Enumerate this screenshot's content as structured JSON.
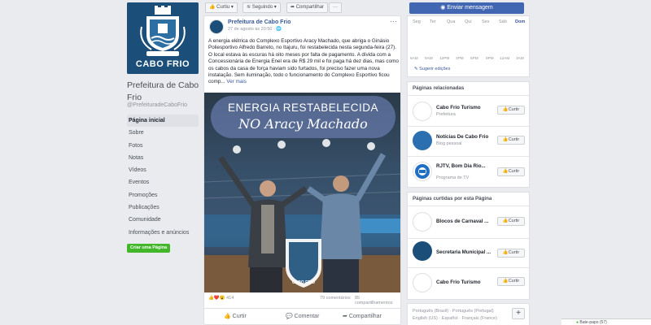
{
  "page": {
    "cover_text": "CABO FRIO",
    "name": "Prefeitura de Cabo Frio",
    "handle": "@PrefeituradeCaboFrio",
    "create_page": "Criar uma Página"
  },
  "nav": [
    {
      "label": "Página inicial"
    },
    {
      "label": "Sobre"
    },
    {
      "label": "Fotos"
    },
    {
      "label": "Notas"
    },
    {
      "label": "Vídeos"
    },
    {
      "label": "Eventos"
    },
    {
      "label": "Promoções"
    },
    {
      "label": "Publicações"
    },
    {
      "label": "Comunidade"
    },
    {
      "label": "Informações e anúncios"
    }
  ],
  "toolbar": {
    "like": "Curtiu",
    "follow": "Seguindo",
    "share": "Compartilhar",
    "more": "···",
    "send_message": "Enviar mensagem"
  },
  "post": {
    "author": "Prefeitura de Cabo Frio",
    "time": "27 de agosto às 20:50 · 🌐",
    "text": "A energia elétrica do Complexo Esportivo Aracy Machado, que abriga o Ginásio Poliesportivo Alfredo Barreto, no Itajuru, foi restabelecida nesta segunda-feira (27). O local estava às escuras há oito meses por falta de pagamento. A dívida com a Concessionária de Energia Enel era de R$ 29 mil e foi paga há dez dias, mas como os cabos da casa de força haviam sido furtados, foi preciso fazer uma nova instalação. Sem iluminação, todo o funcionamento do Complexo Esportivo ficou comp...",
    "see_more": "Ver mais",
    "banner_line1": "ENERGIA RESTABELECIDA",
    "banner_line2": "NO Aracy Machado",
    "image_logo_text": "CABO FRIO",
    "reactions": "414",
    "comments": "79 comentários",
    "shares": "85 compartilhamentos",
    "actions": {
      "like": "Curtir",
      "comment": "Comentar",
      "share": "Compartilhar"
    }
  },
  "calendar": {
    "days": [
      "Seg",
      "Ter",
      "Qua",
      "Qui",
      "Sex",
      "Sáb",
      "Dom"
    ],
    "hours": [
      "6AM",
      "9AM",
      "12PM",
      "3PM",
      "6PM",
      "9PM",
      "12AM",
      "3AM"
    ],
    "suggest": "Sugerir edições"
  },
  "related": {
    "title": "Páginas relacionadas",
    "items": [
      {
        "name": "Cabo Frio Turismo",
        "sub": "Prefeitura",
        "button": "Curtir"
      },
      {
        "name": "Notícias De Cabo Frio",
        "sub": "Blog pessoal",
        "button": "Curtir"
      },
      {
        "name": "RJTV, Bom Dia Rio...",
        "sub": "Programa de TV",
        "button": "Curtir"
      }
    ]
  },
  "liked": {
    "title": "Páginas curtidas por esta Página",
    "items": [
      {
        "name": "Blocos de Carnaval ...",
        "button": "Curtir"
      },
      {
        "name": "Secretaria Municipal ...",
        "button": "Curtir"
      },
      {
        "name": "Cabo Frio Turismo",
        "button": "Curtir"
      }
    ]
  },
  "languages": {
    "line1": "Português (Brasil) · Português (Portugal)",
    "line2": "English (US) · Español · Français (France)",
    "add": "+"
  },
  "chat": {
    "label": "Bate-papo (57)"
  },
  "colors": {
    "fb_blue": "#4267b2",
    "link": "#385898",
    "green": "#42b72a",
    "brand_navy": "#1b4f7a"
  }
}
